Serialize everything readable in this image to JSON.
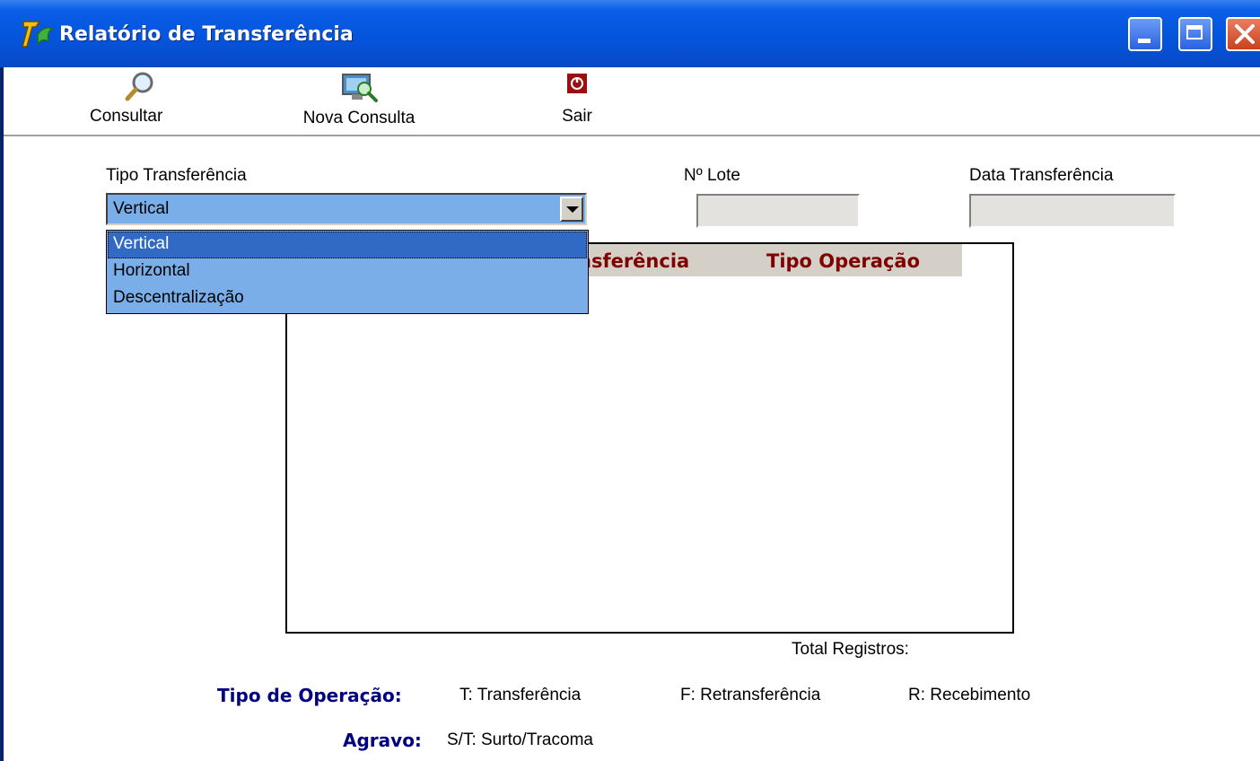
{
  "window": {
    "title": "Relatório de Transferência"
  },
  "toolbar": {
    "consultar": {
      "label": "Consultar",
      "icon": "magnifier-icon"
    },
    "nova_consulta": {
      "label": "Nova Consulta",
      "icon": "monitor-search-icon"
    },
    "sair": {
      "label": "Sair",
      "icon": "power-icon"
    }
  },
  "form": {
    "tipo_transferencia_label": "Tipo Transferência",
    "tipo_transferencia_value": "Vertical",
    "lote_label": "Nº Lote",
    "lote_value": "",
    "data_label": "Data Transferência",
    "data_value": ""
  },
  "dropdown": {
    "options": [
      "Vertical",
      "Horizontal",
      "Descentralização"
    ],
    "selected": "Vertical"
  },
  "grid": {
    "columns": [
      "nsferência",
      "Tipo Operação"
    ]
  },
  "total_registros_label": "Total Registros:",
  "legend": {
    "tipo_operacao_label": "Tipo de Operação:",
    "t": "T: Transferência",
    "f": "F: Retransferência",
    "r": "R: Recebimento",
    "agravo_label": "Agravo:",
    "st": "S/T: Surto/Tracoma"
  },
  "colors": {
    "titlebar": "#0453db",
    "grid_header_text": "#800000",
    "legend_key": "#000080",
    "dropdown_bg": "#79aee8",
    "selected": "#316ac5"
  }
}
